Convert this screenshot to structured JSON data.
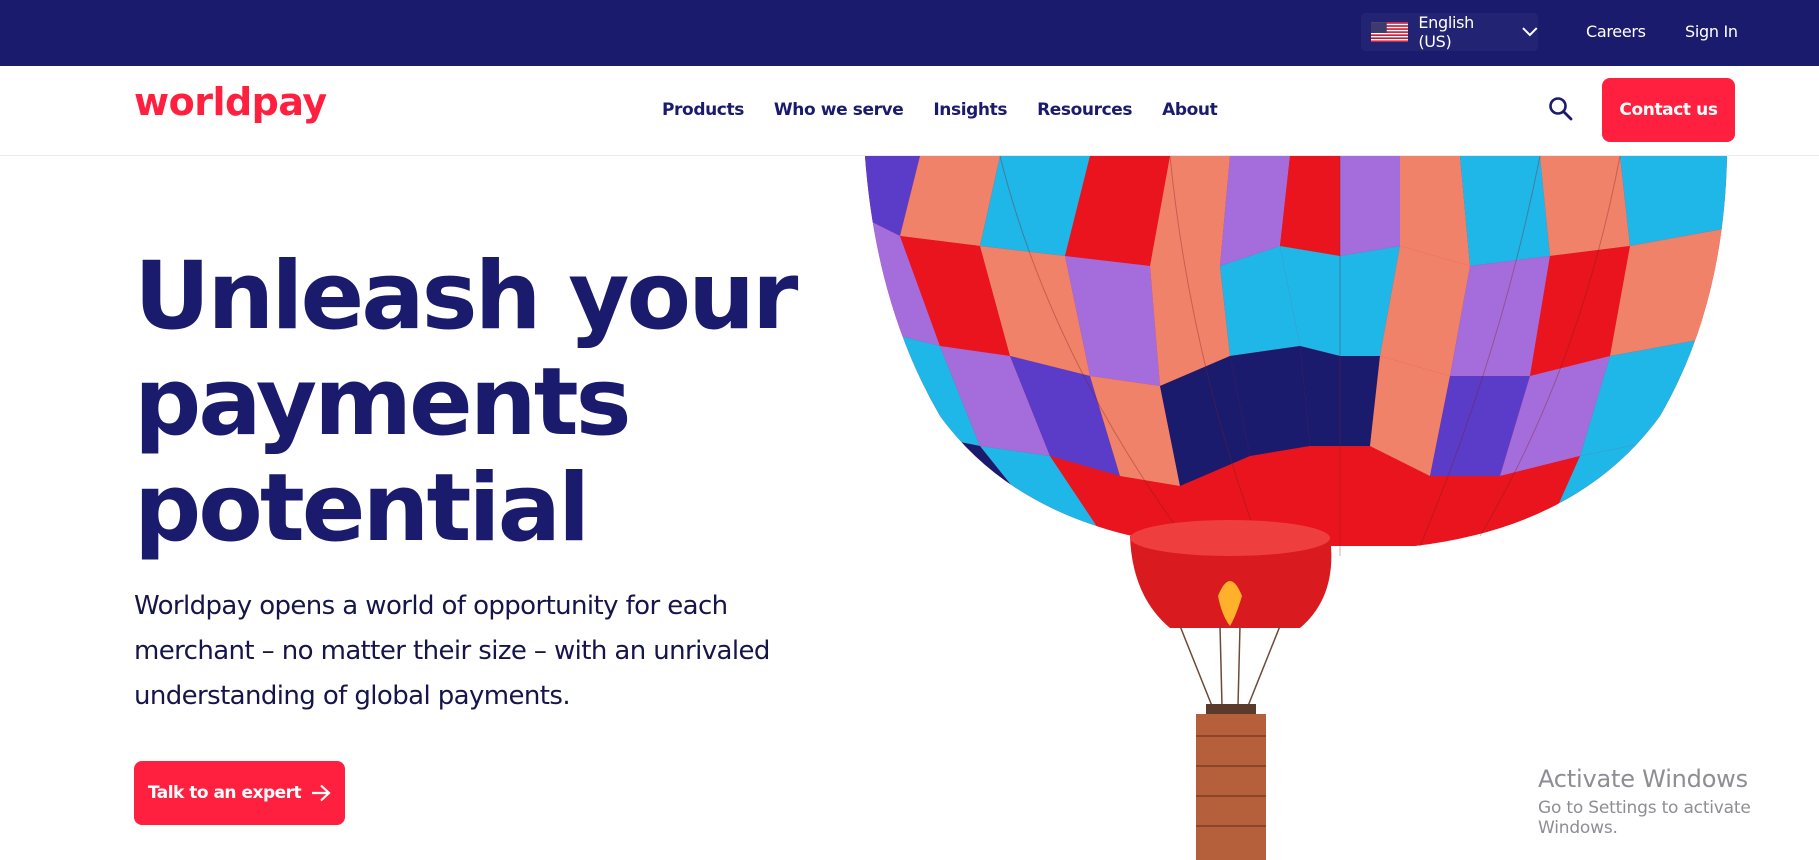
{
  "topbar": {
    "language": {
      "label": "English (US)",
      "flag_icon": "us-flag-icon",
      "chevron_icon": "chevron-down-icon"
    },
    "links": {
      "careers": "Careers",
      "sign_in": "Sign In"
    },
    "background_color": "#1b1b6e"
  },
  "header": {
    "logo": "worldpay",
    "nav": [
      "Products",
      "Who we serve",
      "Insights",
      "Resources",
      "About"
    ],
    "search_icon": "search-icon",
    "contact_button": "Contact us"
  },
  "hero": {
    "title": "Unleash your payments potential",
    "description": "Worldpay opens a world of opportunity for each merchant – no matter their size – with an unrivaled understanding of global payments.",
    "cta_label": "Talk to an expert",
    "cta_icon": "arrow-right-icon",
    "image": "hot-air-balloon-image"
  },
  "watermark": {
    "title": "Activate Windows",
    "subtitle": "Go to Settings to activate Windows."
  },
  "colors": {
    "brand_red": "#ff1f3e",
    "navy": "#1b1b6e",
    "white": "#ffffff"
  }
}
